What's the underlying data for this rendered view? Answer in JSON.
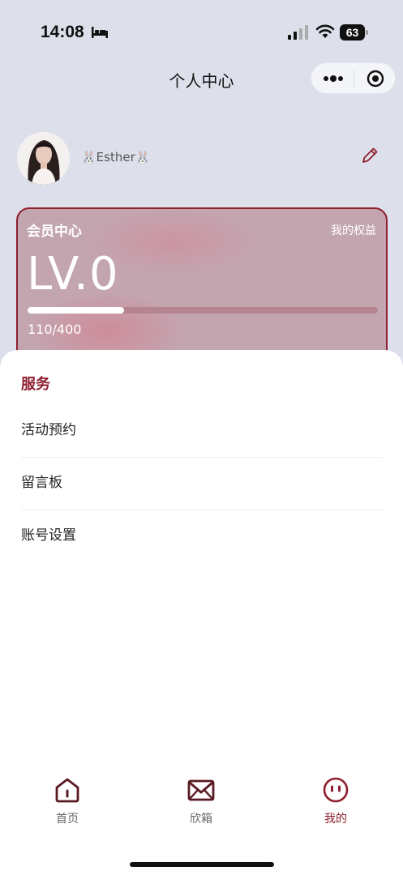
{
  "status_bar": {
    "time": "14:08",
    "battery": "63"
  },
  "nav": {
    "title": "个人中心"
  },
  "profile": {
    "nickname": "🐰Esther🐰"
  },
  "member_card": {
    "title": "会员中心",
    "benefits_link": "我的权益",
    "level": "LV.0",
    "points_text": "110/400",
    "progress": 0.275
  },
  "services": {
    "title": "服务",
    "items": [
      {
        "label": "活动预约"
      },
      {
        "label": "留言板"
      },
      {
        "label": "账号设置"
      }
    ]
  },
  "tabbar": {
    "tabs": [
      {
        "label": "首页",
        "icon": "home-icon"
      },
      {
        "label": "欣箱",
        "icon": "mail-icon"
      },
      {
        "label": "我的",
        "icon": "face-icon",
        "active": true
      }
    ]
  },
  "colors": {
    "accent": "#8f1e2e",
    "background": "#dde0ea"
  }
}
